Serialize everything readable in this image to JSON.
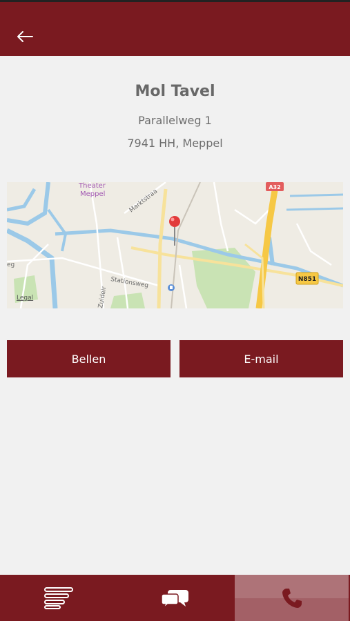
{
  "header": {
    "back_icon": "arrow-left-icon"
  },
  "contact": {
    "name": "Mol Tavel",
    "street": "Parallelweg 1",
    "city_line": "7941 HH, Meppel"
  },
  "map": {
    "labels": {
      "theater": "Theater",
      "meppel": "Meppel",
      "markt": "Marktstraa",
      "stationsweg": "Stationsweg",
      "zuidei": "Zuideir",
      "legal": "Legal",
      "a32": "A32",
      "n851": "N851",
      "partial_eg": "eg"
    }
  },
  "actions": {
    "call_label": "Bellen",
    "email_label": "E-mail"
  },
  "bottom_nav": {
    "items": [
      {
        "icon": "list-icon"
      },
      {
        "icon": "chat-icon"
      },
      {
        "icon": "phone-icon",
        "active": true
      }
    ]
  },
  "colors": {
    "brand": "#7a1a20",
    "active_tab": "#a36066",
    "background": "#f1f1f1",
    "text": "#686868"
  }
}
